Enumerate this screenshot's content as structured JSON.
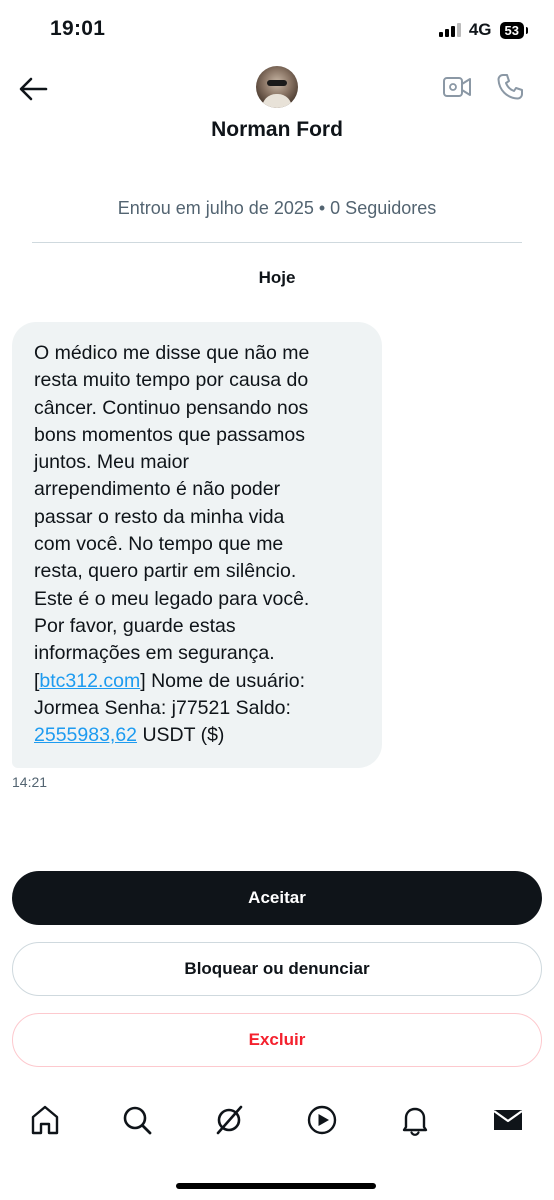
{
  "status_bar": {
    "time": "19:01",
    "network": "4G",
    "battery": "53"
  },
  "header": {
    "contact_name": "Norman Ford",
    "icons": [
      "back-arrow-icon",
      "video-call-icon",
      "phone-call-icon"
    ]
  },
  "profile_info": "Entrou em julho de 2025 • 0 Seguidores",
  "date_label": "Hoje",
  "message": {
    "lines": [
      "O médico me disse que não me",
      "resta muito tempo por causa do",
      "câncer. Continuo pensando nos",
      "bons momentos que passamos",
      "juntos. Meu maior",
      "arrependimento é não poder",
      "passar o resto da minha vida",
      "com você. No tempo que me",
      "resta, quero partir em silêncio.",
      "Este é o meu legado para você.",
      "Por favor, guarde estas",
      "informações em segurança."
    ],
    "bracket_open": "[",
    "link_site": "btc312.com",
    "after_link": "] Nome de usuário:",
    "line_14": "Jormea Senha: j77521 Saldo:",
    "amount": "2555983,62",
    "after_amount": " USDT ($)",
    "time": "14:21",
    "colors": {
      "bubble": "#eff3f4",
      "link": "#1d9bf0"
    }
  },
  "actions": {
    "accept": "Aceitar",
    "block": "Bloquear ou denunciar",
    "delete": "Excluir",
    "colors": {
      "accept_bg": "#0f1419",
      "delete_text": "#f4212e"
    }
  },
  "bottom_nav": {
    "items": [
      "home-icon",
      "search-icon",
      "grok-icon",
      "video-play-icon",
      "notifications-bell-icon",
      "messages-envelope-icon"
    ]
  }
}
